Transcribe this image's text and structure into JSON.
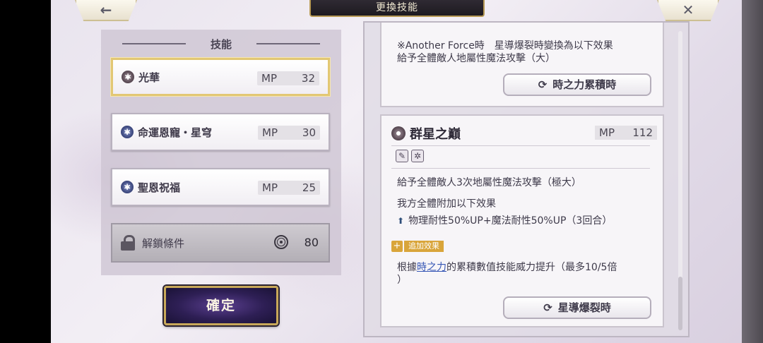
{
  "header": {
    "title": "更換技能",
    "back_icon": "←",
    "close_icon": "✕"
  },
  "skill_list": {
    "header": "技能",
    "items": [
      {
        "name": "光華",
        "mp_label": "MP",
        "mp": "32",
        "selected": true,
        "icon": "brown-star-icon"
      },
      {
        "name": "命運恩寵・星穹",
        "mp_label": "MP",
        "mp": "30",
        "selected": false,
        "icon": "blue-star-icon"
      },
      {
        "name": "聖恩祝福",
        "mp_label": "MP",
        "mp": "25",
        "selected": false,
        "icon": "blue-star-icon"
      }
    ],
    "locked": {
      "name": "解鎖條件",
      "value": "80"
    }
  },
  "confirm_label": "確定",
  "detail": {
    "card1": {
      "line1": "※Another Force時　星導爆裂時變換為以下效果",
      "line2": "給予全體敵人地屬性魔法攻擊（大）",
      "button": "時之力累積時"
    },
    "card2": {
      "title": "群星之巔",
      "mp_label": "MP",
      "mp": "112",
      "desc1": "給予全體敵人3次地屬性魔法攻擊（極大）",
      "desc2": "我方全體附加以下效果",
      "buff": "物理耐性50%UP+魔法耐性50%UP（3回合）",
      "extra_label": "追加效果",
      "extra_pre": "根據",
      "extra_link": "時之力",
      "extra_post": "的累積數值技能威力提升（最多10/5倍",
      "extra_tail": "）",
      "button": "星導爆裂時"
    }
  },
  "colors": {
    "gold_border": "#e2c774",
    "confirm_bg": "#2e1f55",
    "badge": "#d9a53a",
    "link": "#3656b5"
  }
}
